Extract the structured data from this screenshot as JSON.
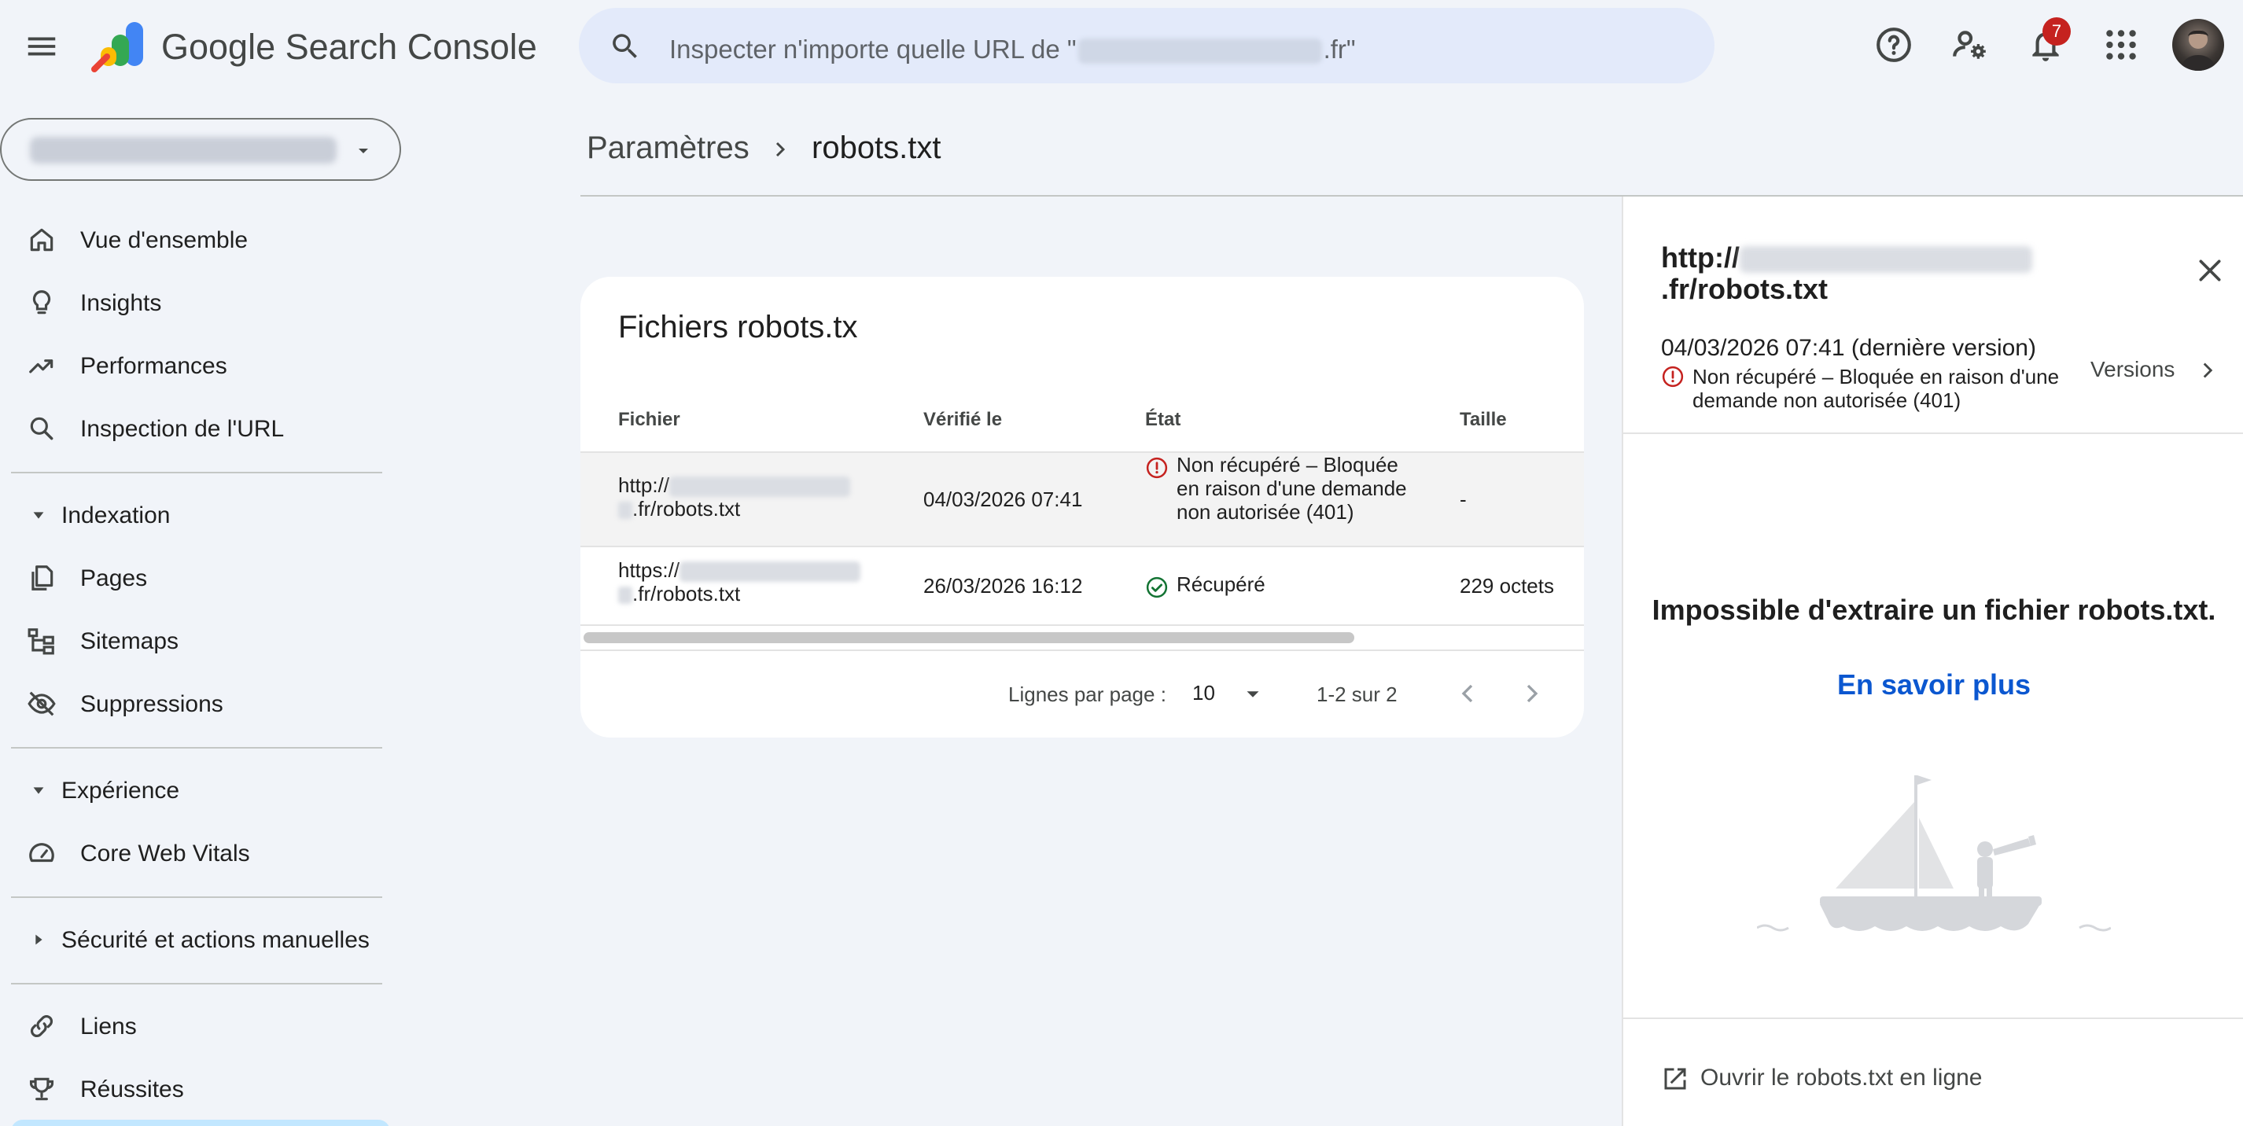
{
  "app": {
    "logo_text": "Google Search Console",
    "notification_count": "7"
  },
  "search": {
    "placeholder_prefix": "Inspecter n'importe quelle URL de \"",
    "placeholder_suffix": ".fr\""
  },
  "sidebar": {
    "items": [
      {
        "label": "Vue d'ensemble",
        "icon": "home-icon"
      },
      {
        "label": "Insights",
        "icon": "lightbulb-icon"
      },
      {
        "label": "Performances",
        "icon": "trending-up-icon"
      },
      {
        "label": "Inspection de l'URL",
        "icon": "search-icon"
      }
    ],
    "sections": {
      "indexation": "Indexation",
      "experience": "Expérience",
      "securite": "Sécurité et actions manuelles"
    },
    "indexation_items": [
      {
        "label": "Pages",
        "icon": "pages-icon"
      },
      {
        "label": "Sitemaps",
        "icon": "sitemap-icon"
      },
      {
        "label": "Suppressions",
        "icon": "eye-off-icon"
      }
    ],
    "experience_items": [
      {
        "label": "Core Web Vitals",
        "icon": "speedometer-icon"
      }
    ],
    "bottom_items": [
      {
        "label": "Liens",
        "icon": "link-icon"
      },
      {
        "label": "Réussites",
        "icon": "trophy-icon"
      }
    ]
  },
  "breadcrumb": {
    "parent": "Paramètres",
    "current": "robots.txt"
  },
  "card": {
    "title": "Fichiers robots.tx",
    "columns": [
      "Fichier",
      "Vérifié le",
      "État",
      "Taille"
    ],
    "rows": [
      {
        "file_prefix": "http://",
        "file_suffix": ".fr/robots.txt",
        "checked": "04/03/2026 07:41",
        "status": "Non récupéré – Bloquée en raison d'une demande non autorisée (401)",
        "status_type": "error",
        "size": "-"
      },
      {
        "file_prefix": "https://",
        "file_suffix": ".fr/robots.txt",
        "checked": "26/03/2026 16:12",
        "status": "Récupéré",
        "status_type": "success",
        "size": "229 octets"
      }
    ],
    "pager": {
      "rows_label": "Lignes par page :",
      "rows_value": "10",
      "range": "1-2 sur 2"
    }
  },
  "panel": {
    "url_prefix": "http://",
    "url_suffix": ".fr/robots.txt",
    "date": "04/03/2026 07:41 (dernière version)",
    "error": "Non récupéré – Bloquée en raison d'une demande non autorisée (401)",
    "versions_label": "Versions",
    "empty_message": "Impossible d'extraire un fichier robots.txt.",
    "learn_more": "En savoir plus",
    "open_live": "Ouvrir le robots.txt en ligne"
  },
  "colors": {
    "background": "#f1f4f9",
    "search_bg": "#e3eafa",
    "link_blue": "#0b57d0",
    "error_red": "#c5221f",
    "success_green": "#137333"
  }
}
